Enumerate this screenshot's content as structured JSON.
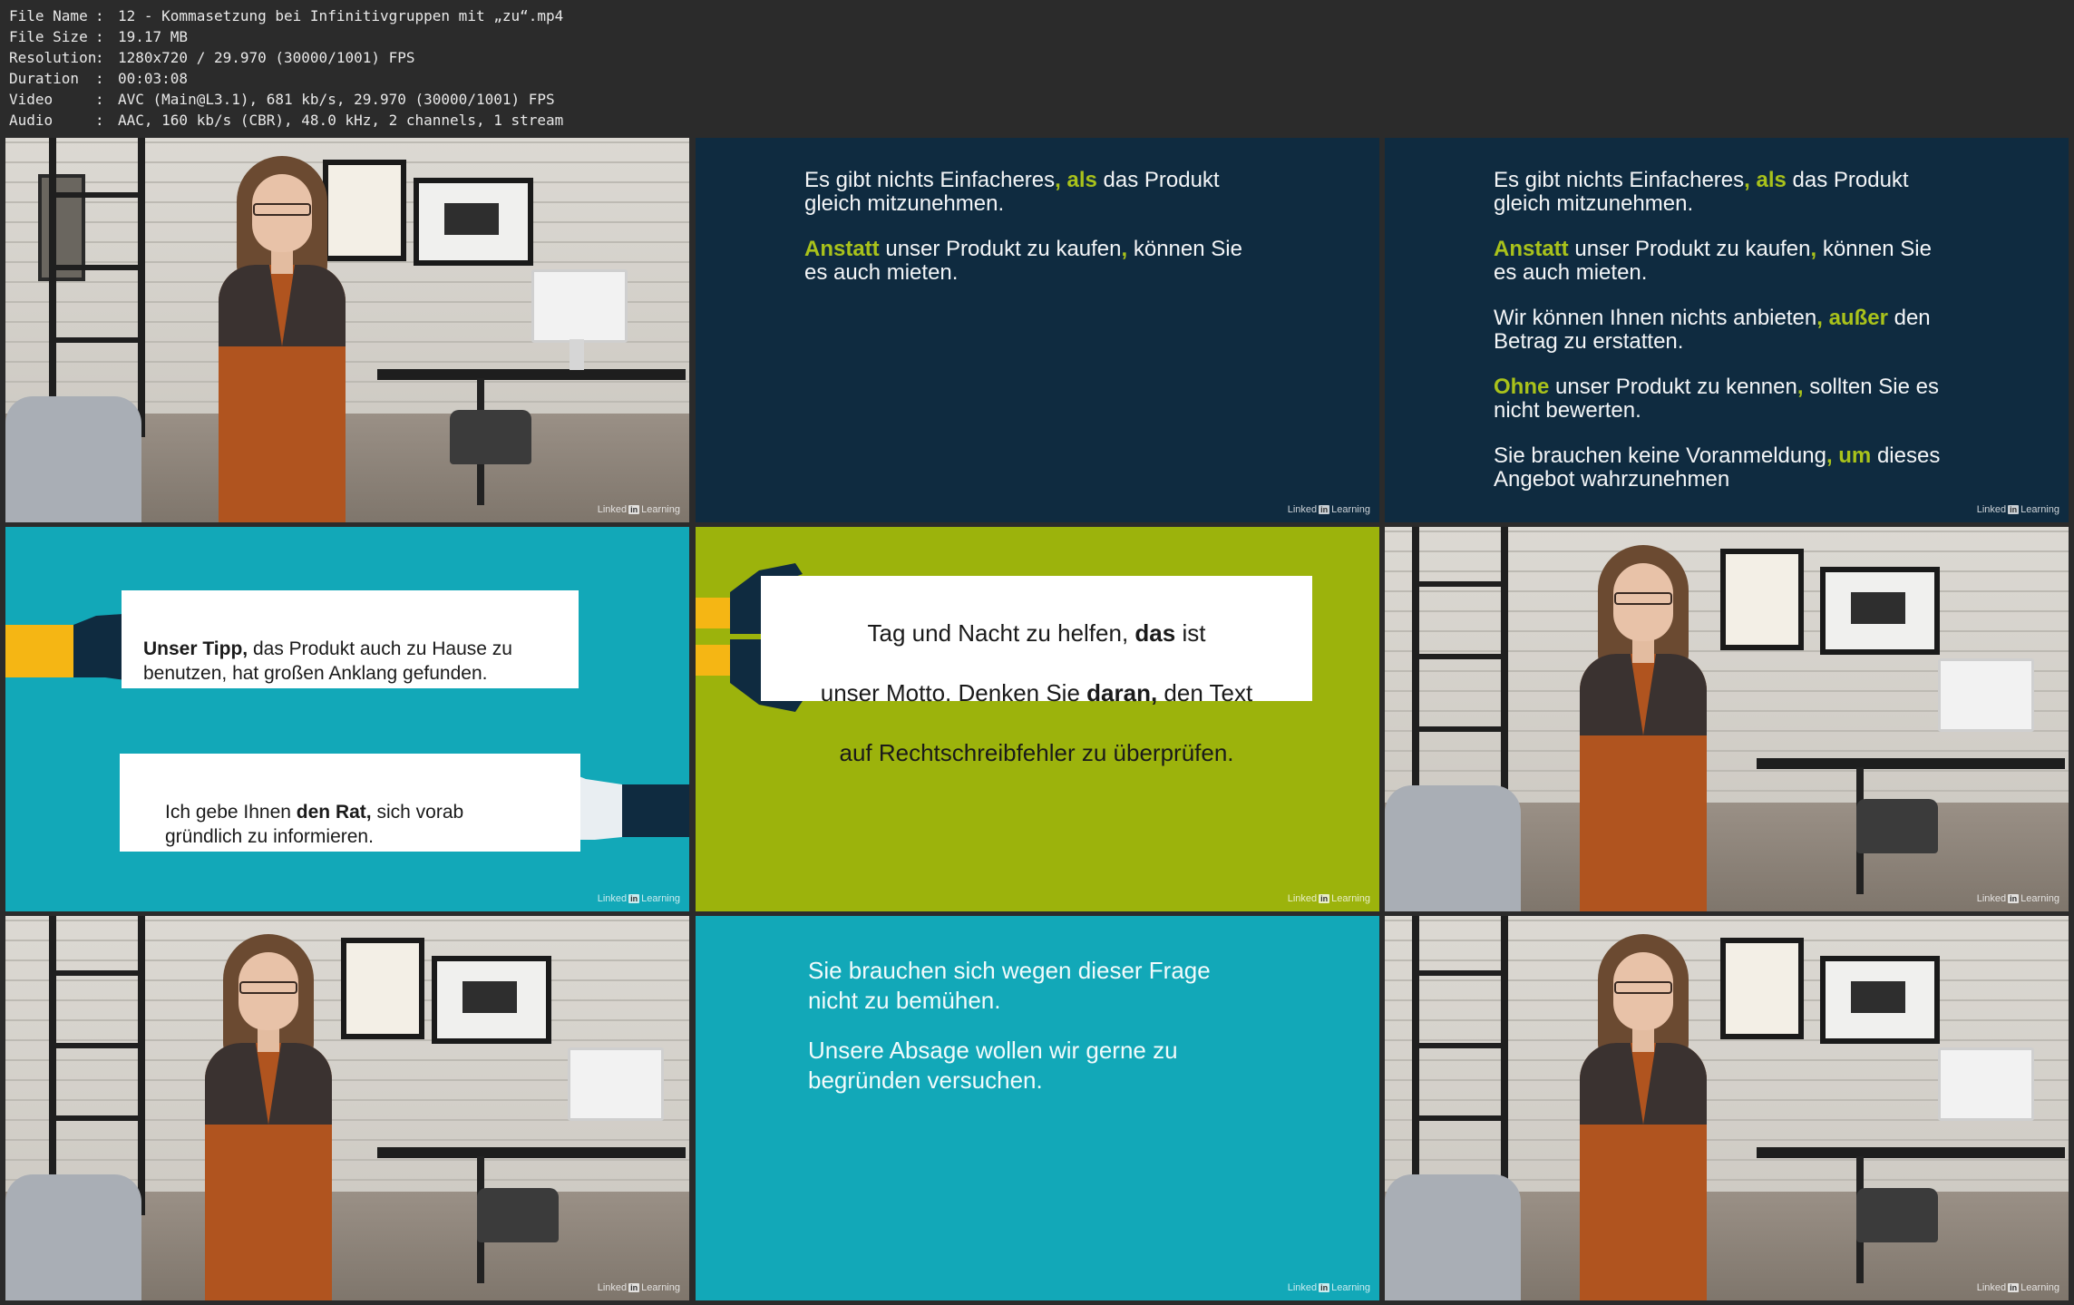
{
  "metadata": [
    {
      "key": "File Name",
      "value": "12 - Kommasetzung bei Infinitivgruppen mit „zu“.mp4"
    },
    {
      "key": "File Size",
      "value": "19.17 MB"
    },
    {
      "key": "Resolution",
      "value": "1280x720 / 29.970 (30000/1001) FPS"
    },
    {
      "key": "Duration",
      "value": "00:03:08"
    },
    {
      "key": "Video",
      "value": "AVC (Main@L3.1), 681 kb/s, 29.970 (30000/1001) FPS"
    },
    {
      "key": "Audio",
      "value": "AAC, 160 kb/s (CBR), 48.0 kHz, 2 channels, 1 stream"
    }
  ],
  "separator": ":",
  "watermark": {
    "brand": "Linked",
    "in": "in",
    "suffix": "Learning"
  },
  "slide2": {
    "lines": [
      {
        "pre": "Es gibt nichts Einfacheres",
        "hl": ", als",
        "post": " das Produkt\ngleich mitzunehmen."
      },
      {
        "pre": "",
        "hl": "Anstatt",
        "post": " unser Produkt zu kaufen",
        "hl2": ",",
        "post2": " können Sie\nes auch mieten."
      }
    ]
  },
  "slide3": {
    "lines": [
      {
        "pre": "Es gibt nichts Einfacheres",
        "hl": ", als",
        "post": " das Produkt\ngleich mitzunehmen."
      },
      {
        "pre": "",
        "hl": "Anstatt",
        "post": " unser Produkt zu kaufen",
        "hl2": ",",
        "post2": " können Sie\nes auch mieten."
      },
      {
        "pre": "Wir können Ihnen nichts anbieten",
        "hl": ", außer",
        "post": " den\nBetrag zu erstatten."
      },
      {
        "pre": "",
        "hl": "Ohne",
        "post": " unser Produkt zu kennen",
        "hl2": ",",
        "post2": " sollten Sie es\nnicht bewerten."
      },
      {
        "pre": "Sie brauchen keine Voranmeldung",
        "hl": ", um",
        "post": " dieses\nAngebot wahrzunehmen"
      }
    ]
  },
  "slide4": {
    "card1": {
      "bold": "Unser Tipp,",
      "text": " das Produkt auch zu Hause zu\nbenutzen, hat großen Anklang gefunden."
    },
    "card2": {
      "pre": "Ich gebe Ihnen ",
      "bold": "den Rat,",
      "text": " sich vorab\ngründlich zu informieren."
    }
  },
  "slide5": {
    "l1pre": "Tag und Nacht zu helfen, ",
    "l1bold": "das",
    "l1post": " ist",
    "l2pre": "unser Motto. Denken Sie ",
    "l2bold": "daran,",
    "l2post": " den Text",
    "l3": "auf Rechtschreibfehler zu überprüfen."
  },
  "slide8": {
    "p1": "Sie brauchen sich wegen dieser Frage\nnicht zu bemühen.",
    "p2": "Unsere Absage wollen wir gerne zu\nbegründen versuchen."
  },
  "colors": {
    "navy": "#0f2b40",
    "highlight": "#a9c21b",
    "teal": "#12a8b8",
    "green": "#9cb30c",
    "yellow": "#f5b614"
  }
}
